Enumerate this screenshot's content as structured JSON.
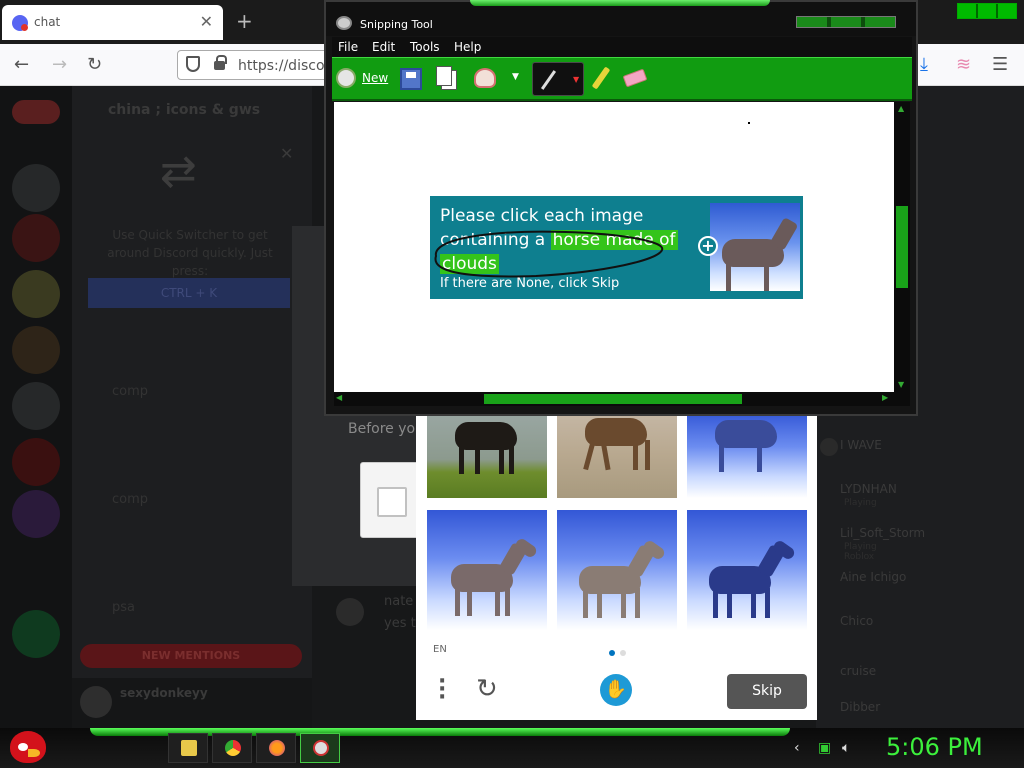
{
  "browser": {
    "tab_title": "chat",
    "url": "https://discord"
  },
  "discord": {
    "server_name": "china ; icons & gws",
    "quick_switcher_text": "Use Quick Switcher to get around Discord quickly. Just press:",
    "quick_switcher_button": "CTRL + K",
    "channels": [
      "comp",
      "comp",
      "psa"
    ],
    "new_mentions": "NEW MENTIONS",
    "username": "sexydonkeyy",
    "before_you": "Before you",
    "message_author": "nate",
    "message_text": "yes t",
    "members": [
      {
        "name": "I WAVE",
        "sub": ""
      },
      {
        "name": "LYDNHAN",
        "sub": "Playing"
      },
      {
        "name": "Lil_Soft_Storm",
        "sub": "Playing Roblox"
      },
      {
        "name": "Aine Ichigo",
        "sub": ""
      },
      {
        "name": "Chico",
        "sub": ""
      },
      {
        "name": "cruise",
        "sub": ""
      },
      {
        "name": "Dibber",
        "sub": ""
      }
    ]
  },
  "captcha": {
    "lang": "EN",
    "skip_label": "Skip"
  },
  "snipping_tool": {
    "title": "Snipping Tool",
    "menu": [
      "File",
      "Edit",
      "Tools",
      "Help"
    ],
    "new_label": "New",
    "prompt": {
      "line1": "Please click each image",
      "line2_pre": "containing a ",
      "line2_hl": "horse made of",
      "line3_hl": "clouds",
      "line4": "If there are None, click Skip"
    }
  },
  "taskbar": {
    "clock": "5:06 PM"
  }
}
